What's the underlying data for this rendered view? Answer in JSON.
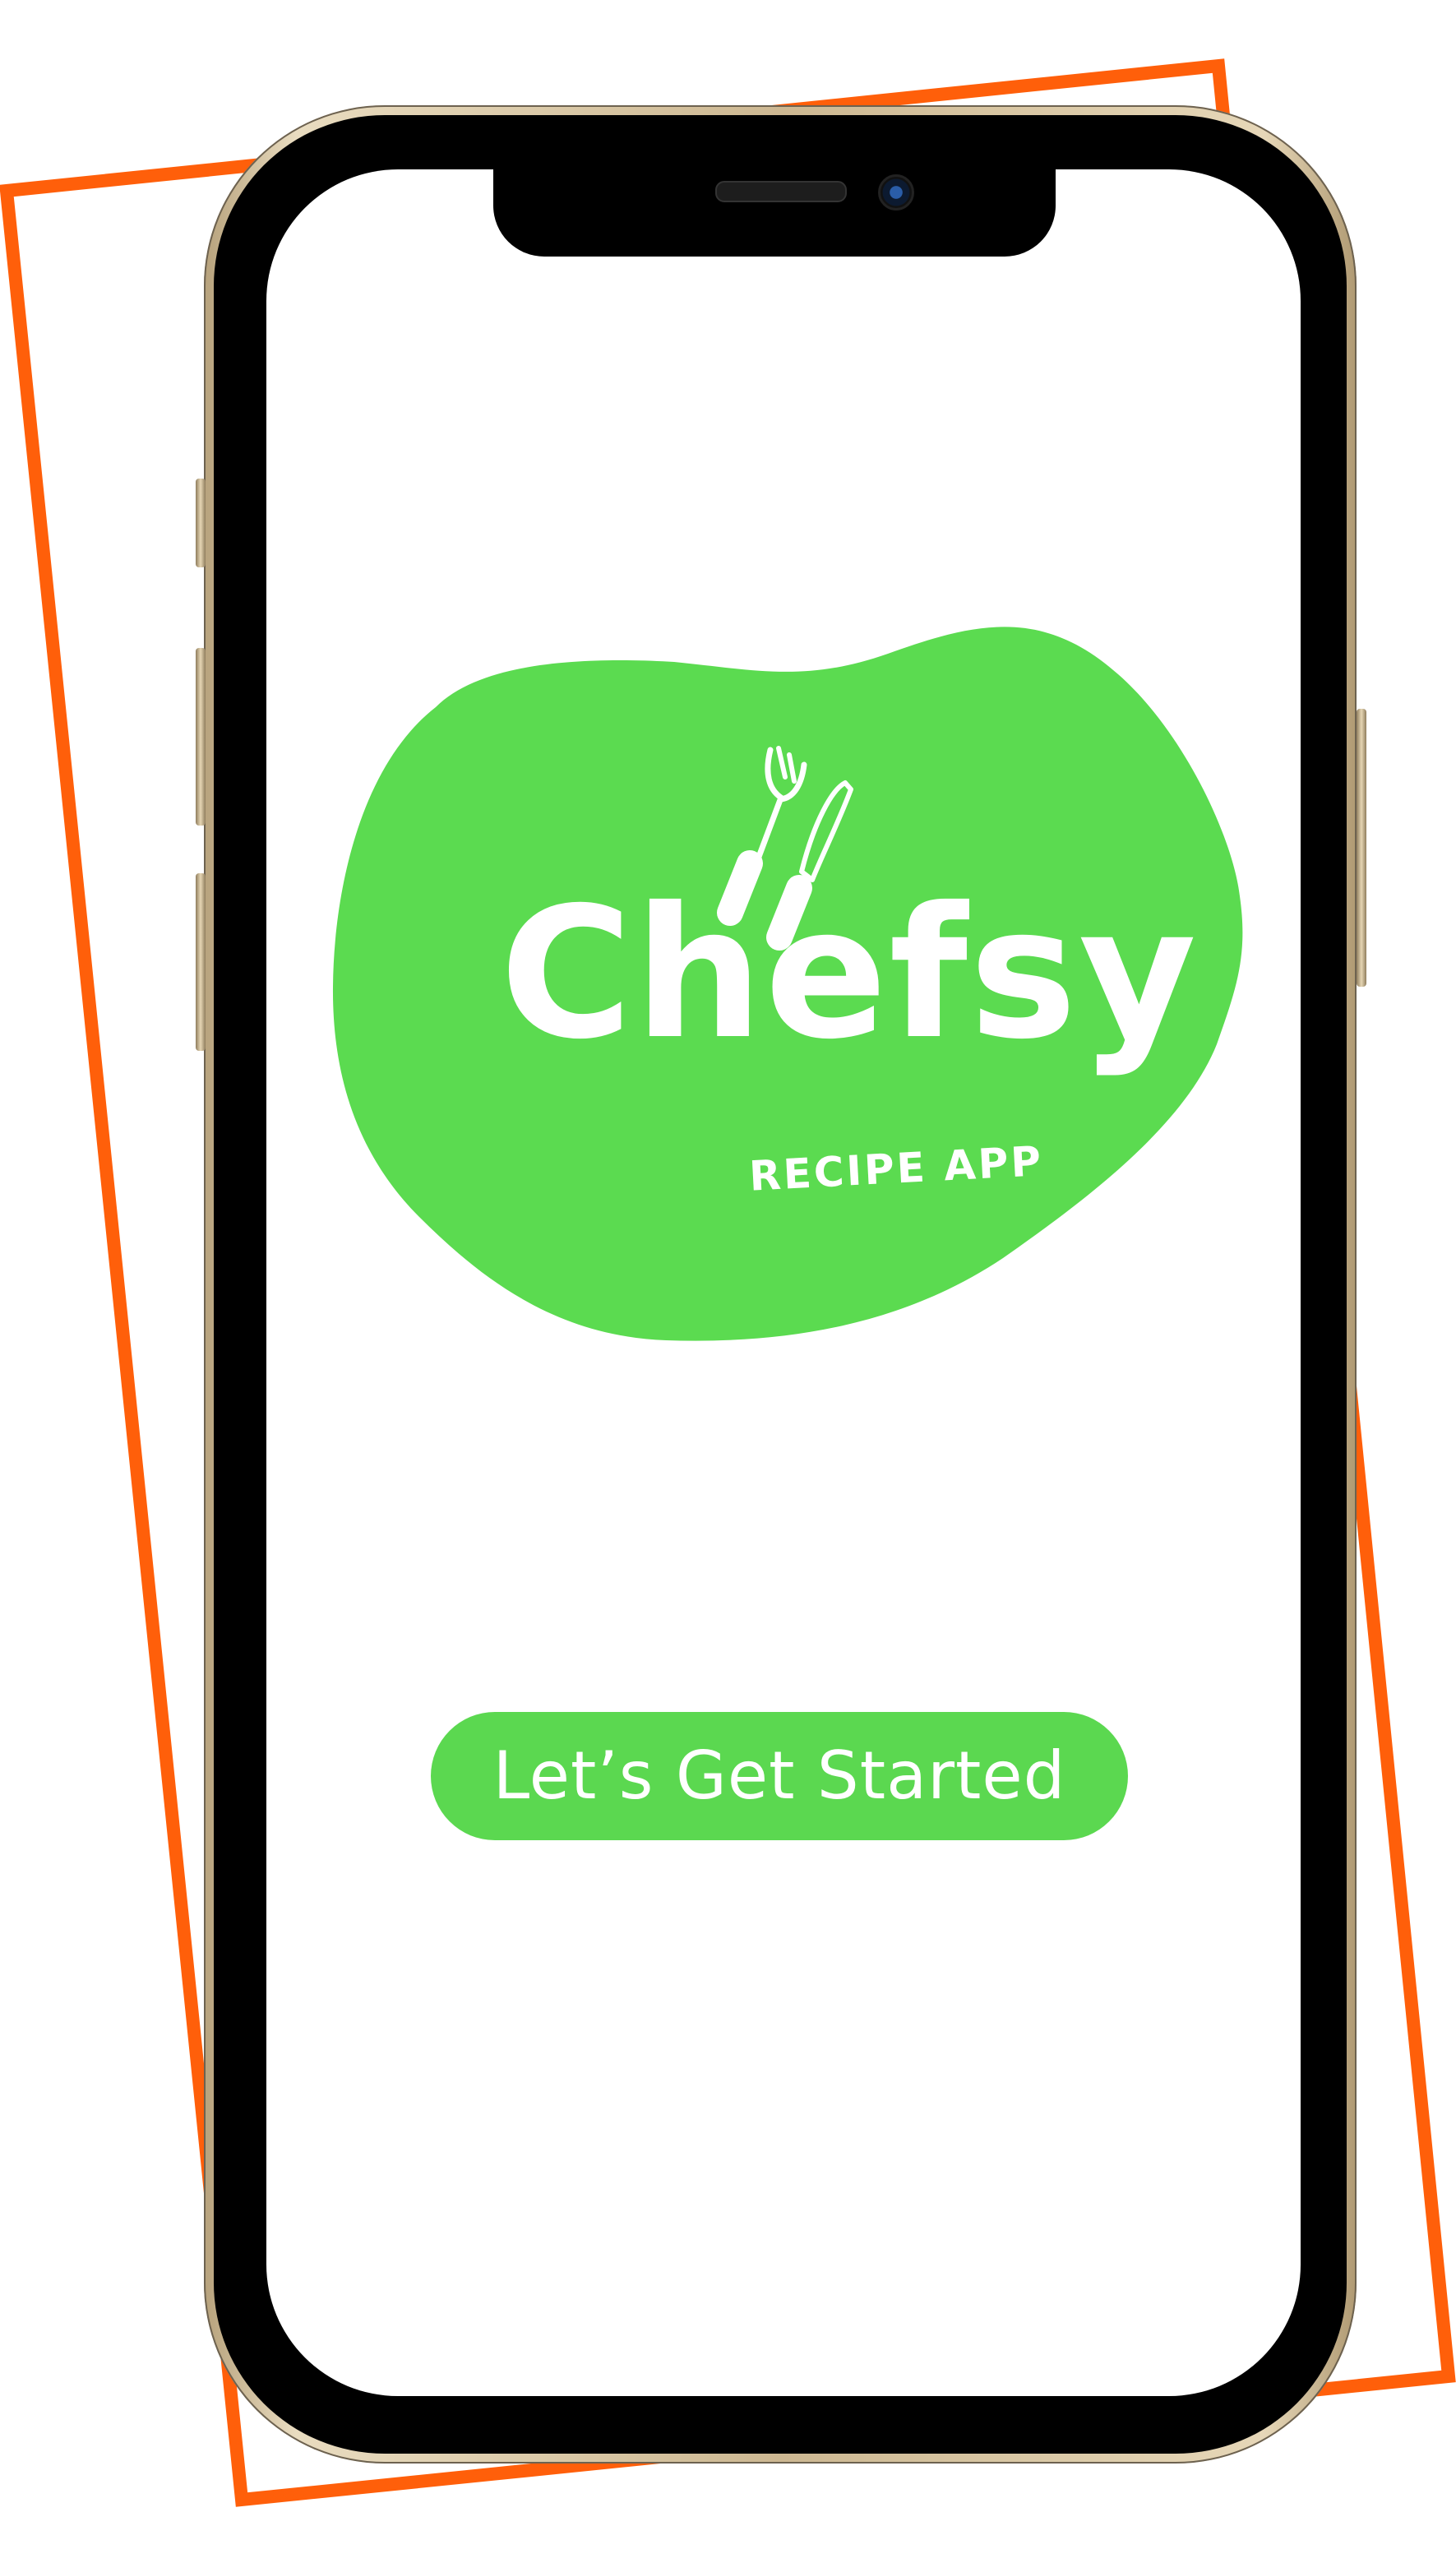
{
  "app": {
    "name": "Chefsy",
    "tagline": "RECIPE APP"
  },
  "cta": {
    "label": "Let’s Get Started"
  },
  "colors": {
    "accent_orange": "#ff5f0a",
    "brand_green": "#5bdb50",
    "button_text": "#ffffff",
    "phone_gold": "#cdb892"
  },
  "icons": {
    "logo_icon": "fork-and-knife-icon"
  }
}
